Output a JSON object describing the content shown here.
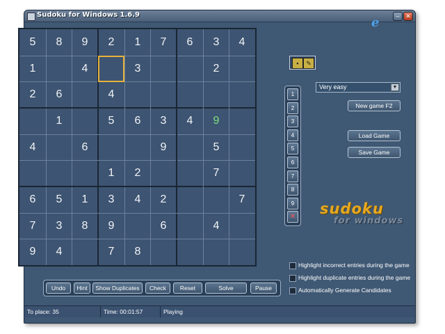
{
  "window": {
    "title": "Sudoku for Windows 1.6.9",
    "minimize_label": "–",
    "close_label": "✕"
  },
  "icons": {
    "app": "sudoku-app-icon",
    "browser": "ie-logo-icon"
  },
  "board": {
    "rows": [
      [
        "5",
        "8",
        "9",
        "2",
        "1",
        "7",
        "6",
        "3",
        "4"
      ],
      [
        "1",
        "",
        "4",
        "",
        "3",
        "",
        "",
        "2",
        ""
      ],
      [
        "2",
        "6",
        "",
        "4",
        "",
        "",
        "",
        "",
        ""
      ],
      [
        "",
        "1",
        "",
        "5",
        "6",
        "3",
        "4",
        "9",
        ""
      ],
      [
        "4",
        "",
        "6",
        "",
        "",
        "9",
        "",
        "5",
        ""
      ],
      [
        "",
        "",
        "",
        "1",
        "2",
        "",
        "",
        "7",
        ""
      ],
      [
        "6",
        "5",
        "1",
        "3",
        "4",
        "2",
        "",
        "",
        "7"
      ],
      [
        "7",
        "3",
        "8",
        "9",
        "",
        "6",
        "",
        "4",
        ""
      ],
      [
        "9",
        "4",
        "",
        "7",
        "8",
        "",
        "",
        "",
        ""
      ]
    ],
    "selected_cell": {
      "row": 1,
      "col": 3
    },
    "user_entered": [
      {
        "row": 3,
        "col": 7
      }
    ]
  },
  "numpad": {
    "buttons": [
      "1",
      "2",
      "3",
      "4",
      "5",
      "6",
      "7",
      "8",
      "9"
    ],
    "erase_label": "✕"
  },
  "difficulty": {
    "selected": "Very easy"
  },
  "buttons": {
    "new_game": "New game F2",
    "load_game": "Load Game",
    "save_game": "Save Game"
  },
  "logo": {
    "line1": "sudoku",
    "line2": "for windows"
  },
  "options": [
    {
      "label": "Highlight incorrect entries during the game",
      "checked": false
    },
    {
      "label": "Highlight duplicate entries during the game",
      "checked": false
    },
    {
      "label": "Automatically Generate Candidates",
      "checked": false
    }
  ],
  "toolbar": {
    "undo": "Undo",
    "hint": "Hint",
    "show_duplicates": "Show Duplicates",
    "check": "Check",
    "reset": "Reset",
    "solve": "Solve",
    "pause": "Pause"
  },
  "status": {
    "to_place": "To place: 35",
    "time": "Time: 00:01:57",
    "state": "Playing"
  },
  "colors": {
    "accent": "#e8b23a",
    "user_digit": "#7fe07f",
    "background": "#3f5874"
  }
}
